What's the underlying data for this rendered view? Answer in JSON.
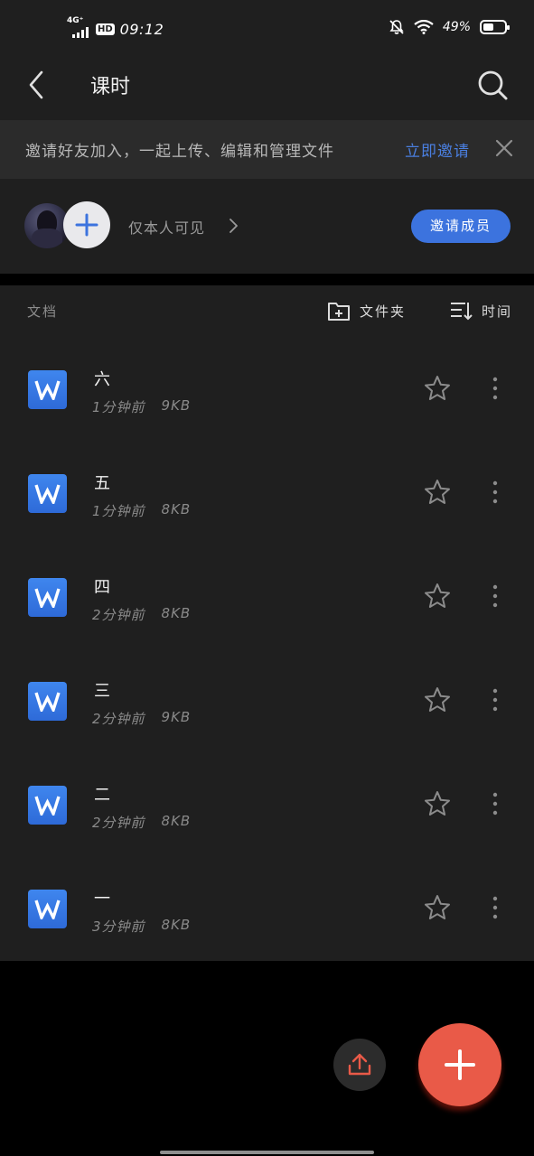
{
  "status_bar": {
    "network": "4G⁺",
    "hd": "HD",
    "time": "09:12",
    "battery": "49%",
    "battery_level": 0.49
  },
  "header": {
    "title": "课时",
    "back_icon": "chevron-left-icon",
    "search_icon": "search-icon"
  },
  "invite_banner": {
    "text": "邀请好友加入，一起上传、编辑和管理文件",
    "link": "立即邀请",
    "close_icon": "close-icon"
  },
  "members": {
    "visibility": "仅本人可见",
    "invite_button": "邀请成员"
  },
  "documents": {
    "section_label": "文档",
    "folder_button": "文件夹",
    "sort_button": "时间",
    "items": [
      {
        "name": "六",
        "time": "1分钟前",
        "size": "9KB"
      },
      {
        "name": "五",
        "time": "1分钟前",
        "size": "8KB"
      },
      {
        "name": "四",
        "time": "2分钟前",
        "size": "8KB"
      },
      {
        "name": "三",
        "time": "2分钟前",
        "size": "9KB"
      },
      {
        "name": "二",
        "time": "2分钟前",
        "size": "8KB"
      },
      {
        "name": "一",
        "time": "3分钟前",
        "size": "8KB"
      }
    ]
  },
  "colors": {
    "accent_blue": "#3c73de",
    "fab_red": "#e95a48",
    "doc_icon_blue": "#3f86ee"
  }
}
